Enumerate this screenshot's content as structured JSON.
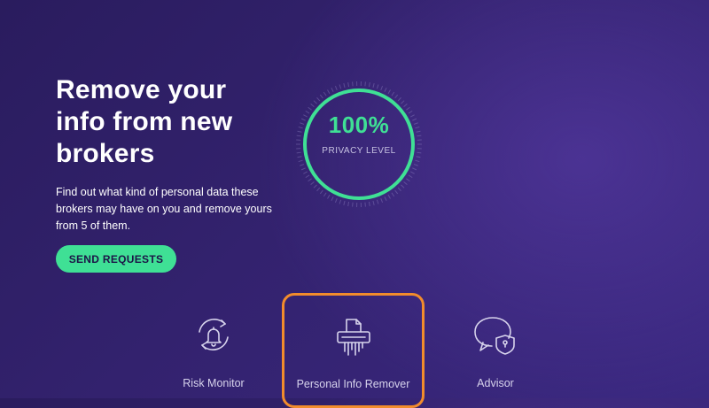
{
  "hero": {
    "title_lines": [
      "Remove your",
      "info from new",
      "brokers"
    ],
    "description": "Find out what kind of personal data these brokers may have on you and remove yours from 5 of them.",
    "cta_label": "SEND REQUESTS"
  },
  "privacy_gauge": {
    "value_text": "100%",
    "label": "PRIVACY LEVEL",
    "level": 1.0
  },
  "feature_tabs": [
    {
      "label": "Risk Monitor",
      "icon": "bell-refresh-icon",
      "selected": false
    },
    {
      "label": "Personal Info Remover",
      "icon": "shredder-icon",
      "selected": true
    },
    {
      "label": "Advisor",
      "icon": "shield-chat-icon",
      "selected": false
    }
  ],
  "colors": {
    "accent": "#3fe095",
    "highlight_border": "#f28c2c",
    "background": "#2f2068"
  }
}
